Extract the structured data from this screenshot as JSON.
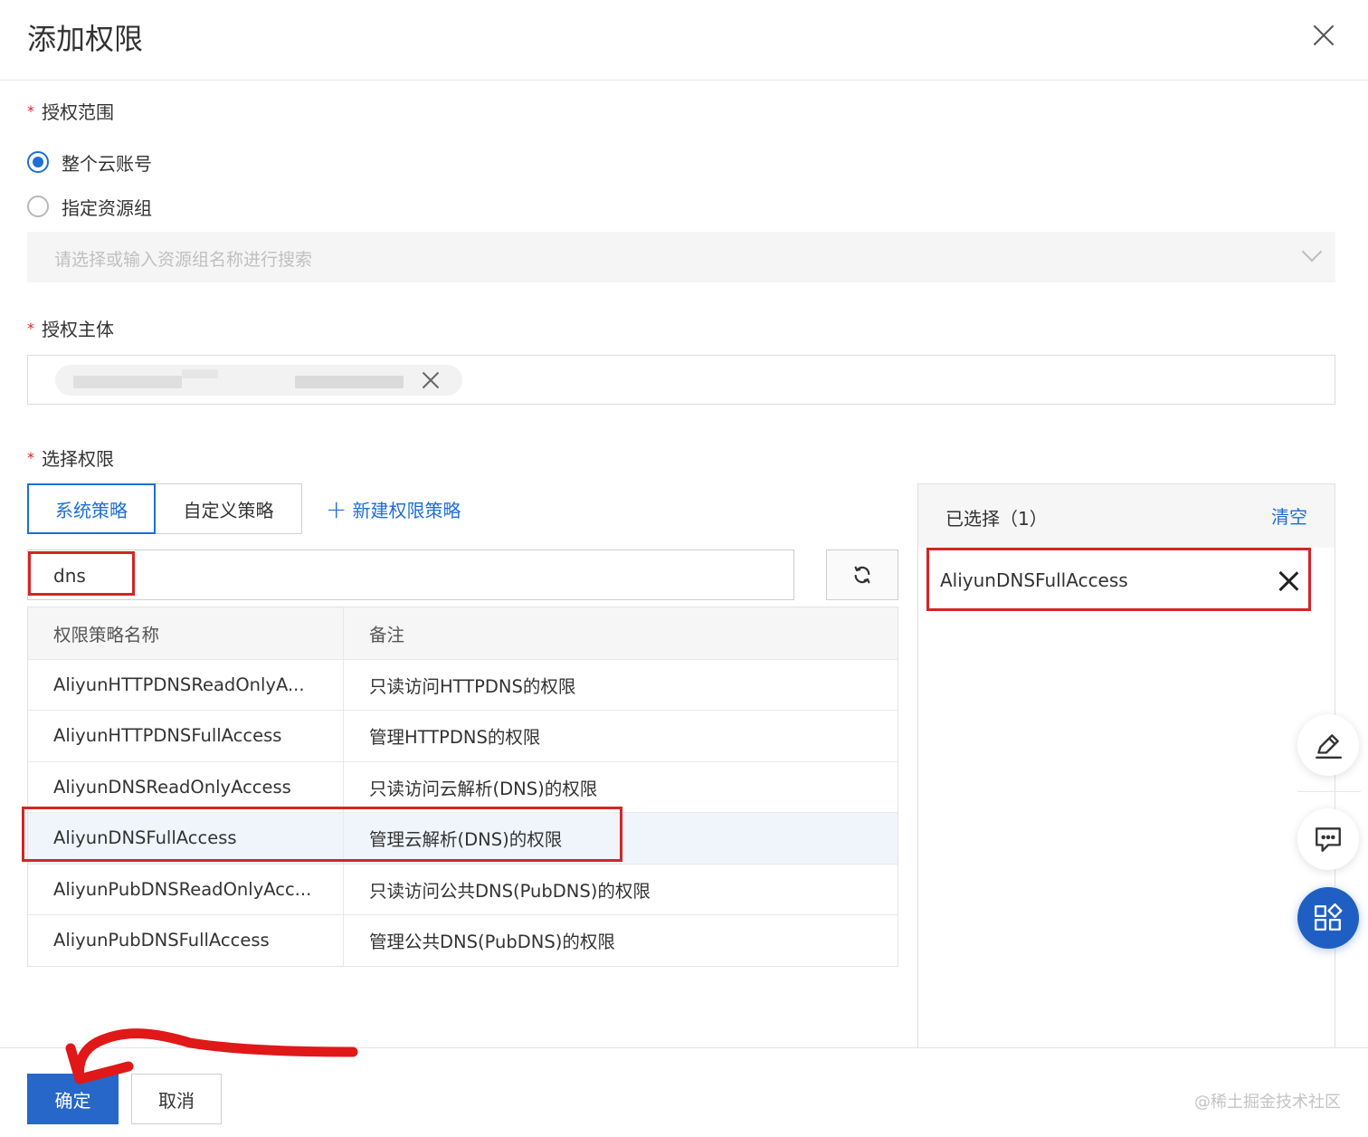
{
  "dialog": {
    "title": "添加权限"
  },
  "scope": {
    "label": "授权范围",
    "required_mark": "*",
    "options": [
      {
        "label": "整个云账号",
        "selected": true
      },
      {
        "label": "指定资源组",
        "selected": false
      }
    ],
    "resource_group_placeholder": "请选择或输入资源组名称进行搜索"
  },
  "principal": {
    "label": "授权主体",
    "required_mark": "*"
  },
  "permissions": {
    "label": "选择权限",
    "required_mark": "*",
    "tabs": [
      {
        "label": "系统策略",
        "active": true
      },
      {
        "label": "自定义策略",
        "active": false
      }
    ],
    "new_policy_label": "新建权限策略",
    "search_value": "dns",
    "table": {
      "headers": [
        "权限策略名称",
        "备注"
      ],
      "rows": [
        {
          "name": "AliyunHTTPDNSReadOnlyA...",
          "note": "只读访问HTTPDNS的权限"
        },
        {
          "name": "AliyunHTTPDNSFullAccess",
          "note": "管理HTTPDNS的权限"
        },
        {
          "name": "AliyunDNSReadOnlyAccess",
          "note": "只读访问云解析(DNS)的权限"
        },
        {
          "name": "AliyunDNSFullAccess",
          "note": "管理云解析(DNS)的权限"
        },
        {
          "name": "AliyunPubDNSReadOnlyAcc...",
          "note": "只读访问公共DNS(PubDNS)的权限"
        },
        {
          "name": "AliyunPubDNSFullAccess",
          "note": "管理公共DNS(PubDNS)的权限"
        }
      ]
    }
  },
  "selected_panel": {
    "title": "已选择（1）",
    "clear_label": "清空",
    "items": [
      {
        "label": "AliyunDNSFullAccess"
      }
    ]
  },
  "footer": {
    "ok_label": "确定",
    "cancel_label": "取消",
    "watermark": "@稀土掘金技术社区"
  },
  "colors": {
    "primary": "#1f6ed4",
    "annotation_red": "#d42525"
  },
  "icons": [
    "close-icon",
    "chevron-down-icon",
    "refresh-icon",
    "plus-icon",
    "edit-icon",
    "feedback-icon",
    "apps-icon"
  ]
}
